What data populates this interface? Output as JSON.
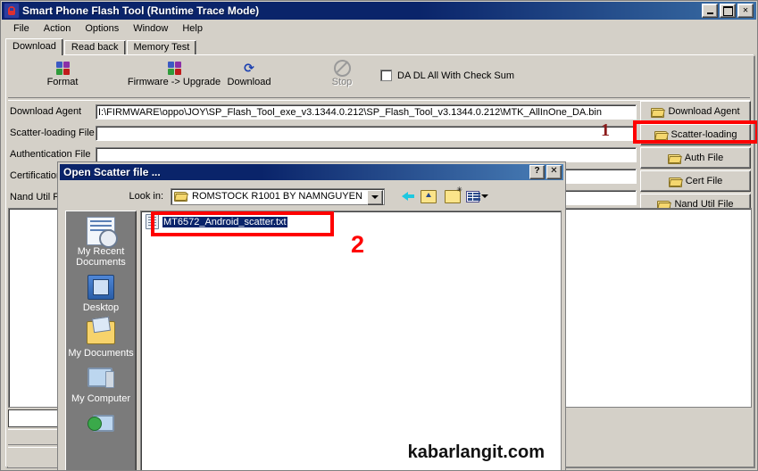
{
  "window": {
    "title": "Smart Phone Flash Tool (Runtime Trace Mode)",
    "icon": "app-icon",
    "buttons": {
      "minimize": "_",
      "maximize": "□",
      "close": "×"
    }
  },
  "menu": {
    "items": [
      "File",
      "Action",
      "Options",
      "Window",
      "Help"
    ]
  },
  "tabs": [
    {
      "label": "Download",
      "active": true
    },
    {
      "label": "Read back",
      "active": false
    },
    {
      "label": "Memory Test",
      "active": false
    }
  ],
  "toolbar": {
    "items": [
      {
        "label": "Format",
        "icon": "recycle-icon",
        "disabled": false
      },
      {
        "label": "Firmware -> Upgrade",
        "icon": "recycle-icon",
        "disabled": false
      },
      {
        "label": "Download",
        "icon": "download-arrow-icon",
        "disabled": false
      },
      {
        "label": "Stop",
        "icon": "stop-icon",
        "disabled": true
      }
    ],
    "checkbox": {
      "label": "DA DL All With Check Sum",
      "checked": false
    }
  },
  "fields": [
    {
      "label": "Download Agent",
      "value": "I:\\FIRMWARE\\oppo\\JOY\\SP_Flash_Tool_exe_v3.1344.0.212\\SP_Flash_Tool_v3.1344.0.212\\MTK_AllInOne_DA.bin"
    },
    {
      "label": "Scatter-loading File",
      "value": ""
    },
    {
      "label": "Authentication File",
      "value": ""
    },
    {
      "label": "Certification File",
      "value": ""
    },
    {
      "label": "Nand Util File",
      "value": ""
    }
  ],
  "side_buttons": [
    {
      "label": "Download Agent",
      "icon": "folder-icon"
    },
    {
      "label": "Scatter-loading",
      "icon": "folder-icon"
    },
    {
      "label": "Auth File",
      "icon": "folder-icon"
    },
    {
      "label": "Cert File",
      "icon": "folder-icon"
    },
    {
      "label": "Nand Util File",
      "icon": "folder-icon"
    }
  ],
  "dialog": {
    "title": "Open Scatter file ...",
    "help_button": "?",
    "close_button": "✕",
    "look_in_label": "Look in:",
    "look_in_value": "ROMSTOCK R1001 BY NAMNGUYEN",
    "nav_icons": [
      "back-icon",
      "up-one-level-icon",
      "new-folder-icon",
      "views-icon"
    ],
    "places": [
      {
        "label": "My Recent\nDocuments",
        "icon": "recent-documents-icon"
      },
      {
        "label": "Desktop",
        "icon": "desktop-icon"
      },
      {
        "label": "My Documents",
        "icon": "my-documents-icon"
      },
      {
        "label": "My Computer",
        "icon": "my-computer-icon"
      },
      {
        "label": "",
        "icon": "my-network-places-icon"
      }
    ],
    "files": [
      {
        "name": "MT6572_Android_scatter.txt",
        "icon": "text-file-icon",
        "selected": true
      }
    ],
    "watermark": "kabarlangit.com"
  },
  "annotations": {
    "step1": {
      "text": "1",
      "color": "#8b1a1a"
    },
    "step2": {
      "text": "2",
      "color": "#ff0000"
    },
    "highlight_color": "#ff0000"
  }
}
